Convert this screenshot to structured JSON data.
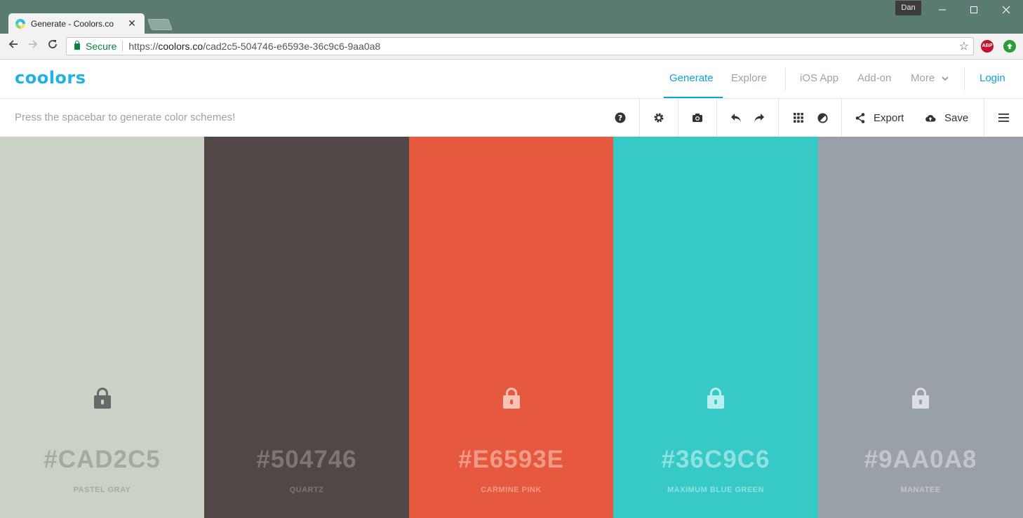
{
  "browser": {
    "tab_title": "Generate - Coolors.co",
    "tab_close": "✕",
    "profile_name": "Dan",
    "secure_label": "Secure",
    "url_scheme": "https://",
    "url_host": "coolors.co",
    "url_path": "/cad2c5-504746-e6593e-36c9c6-9aa0a8",
    "ext_abp": "ABP"
  },
  "app": {
    "logo": "coolors",
    "nav": {
      "generate": "Generate",
      "explore": "Explore",
      "ios_app": "iOS App",
      "addon": "Add-on",
      "more": "More",
      "login": "Login"
    },
    "hint": "Press the spacebar to generate color schemes!",
    "toolbar": {
      "export_label": "Export",
      "save_label": "Save"
    }
  },
  "palette": [
    {
      "hex": "#CAD2C5",
      "name": "PASTEL GRAY",
      "bg": "#cad2c5",
      "text_color": "#a4aaa0",
      "lock_color": "#666b69"
    },
    {
      "hex": "#504746",
      "name": "QUARTZ",
      "bg": "#504746",
      "text_color": "#7c7675",
      "lock_color": "#7c7675"
    },
    {
      "hex": "#E6593E",
      "name": "CARMINE PINK",
      "bg": "#e6593e",
      "text_color": "#f09a88",
      "lock_color": "#f6c3b7"
    },
    {
      "hex": "#36C9C6",
      "name": "MAXIMUM BLUE GREEN",
      "bg": "#36c9c6",
      "text_color": "#8ee2df",
      "lock_color": "#b9efed"
    },
    {
      "hex": "#9AA0A8",
      "name": "MANATEE",
      "bg": "#9aa0a8",
      "text_color": "#c2c6cb",
      "lock_color": "#dcdfe2"
    }
  ],
  "colors": {
    "accent": "#0ea2d8",
    "logo": "#1fb2e8",
    "window_frame": "#5a7b72"
  },
  "icons": [
    "help-icon",
    "settings-icon",
    "camera-icon",
    "undo-icon",
    "redo-icon",
    "grid-icon",
    "contrast-icon",
    "share-icon",
    "cloud-upload-icon",
    "hamburger-icon"
  ]
}
